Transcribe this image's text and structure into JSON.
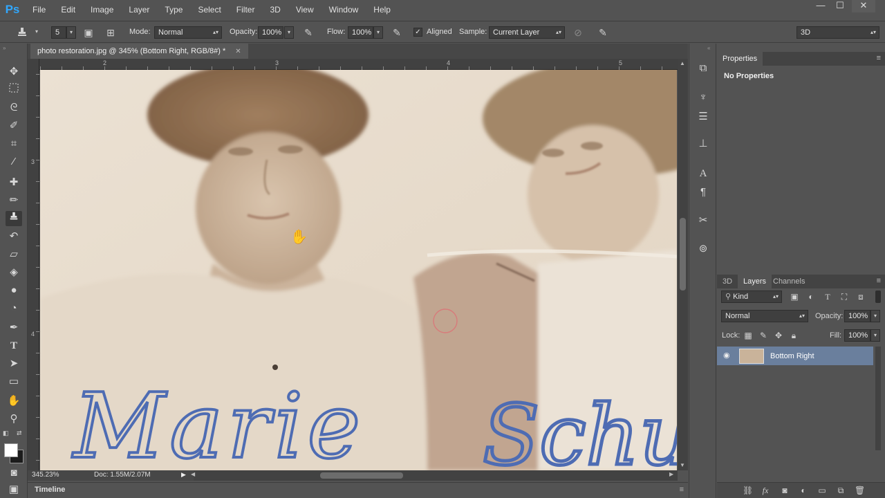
{
  "app": {
    "logo": "Ps"
  },
  "menu": [
    "File",
    "Edit",
    "Image",
    "Layer",
    "Type",
    "Select",
    "Filter",
    "3D",
    "View",
    "Window",
    "Help"
  ],
  "window_controls": {
    "minimize": "—",
    "maximize": "☐",
    "close": "✕"
  },
  "options_bar": {
    "brush_size": "5",
    "mode_label": "Mode:",
    "mode_value": "Normal",
    "opacity_label": "Opacity:",
    "opacity_value": "100%",
    "flow_label": "Flow:",
    "flow_value": "100%",
    "aligned_label": "Aligned",
    "aligned_checked": true,
    "sample_label": "Sample:",
    "sample_value": "Current Layer",
    "workspace_value": "3D"
  },
  "document": {
    "tab_title": "photo restoration.jpg @ 345% (Bottom Right, RGB/8#) *",
    "ruler_top": [
      "2",
      "3",
      "4",
      "5"
    ],
    "ruler_left": [
      "3",
      "4"
    ],
    "signature_left": "Marie",
    "signature_right": "Schu"
  },
  "status": {
    "zoom": "345.23%",
    "doc": "Doc: 1.55M/2.07M"
  },
  "timeline": {
    "label": "Timeline"
  },
  "properties_panel": {
    "tab": "Properties",
    "content": "No Properties"
  },
  "layers_panel": {
    "tabs": [
      "3D",
      "Layers",
      "Channels"
    ],
    "active_tab": "Layers",
    "filter_kind": "Kind",
    "blend_mode": "Normal",
    "opacity_label": "Opacity:",
    "opacity_value": "100%",
    "lock_label": "Lock:",
    "fill_label": "Fill:",
    "fill_value": "100%",
    "layers": [
      {
        "name": "Bottom Right",
        "visible": true,
        "selected": true
      }
    ]
  },
  "colors": {
    "accent": "#31a8ff",
    "selected_layer": "#6a7f9d",
    "panel_bg": "#535353"
  }
}
